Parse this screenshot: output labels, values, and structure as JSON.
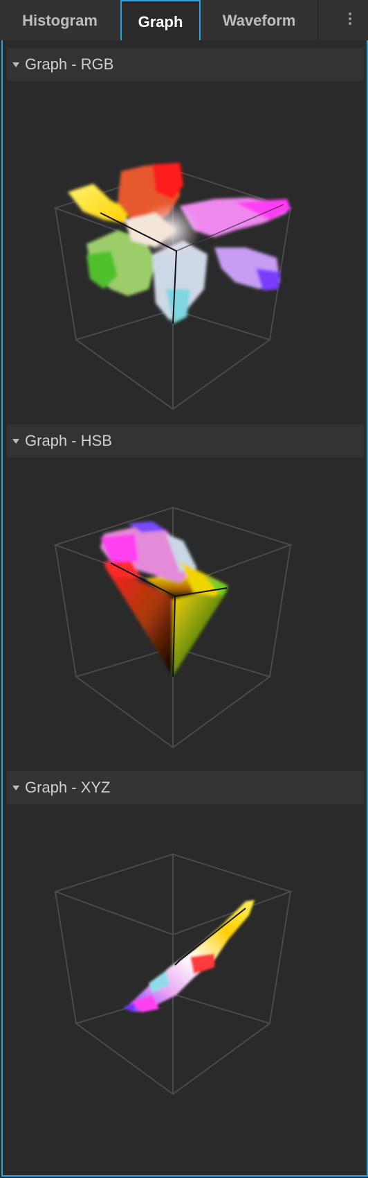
{
  "tabs": [
    {
      "label": "Histogram",
      "active": false
    },
    {
      "label": "Graph",
      "active": true
    },
    {
      "label": "Waveform",
      "active": false
    }
  ],
  "accent_color": "#2aa6e6",
  "sections": [
    {
      "title": "Graph - RGB"
    },
    {
      "title": "Graph - HSB"
    },
    {
      "title": "Graph - XYZ"
    }
  ],
  "icons": {
    "overflow_menu": "vertical-ellipsis-icon",
    "collapse": "triangle-down-icon"
  }
}
